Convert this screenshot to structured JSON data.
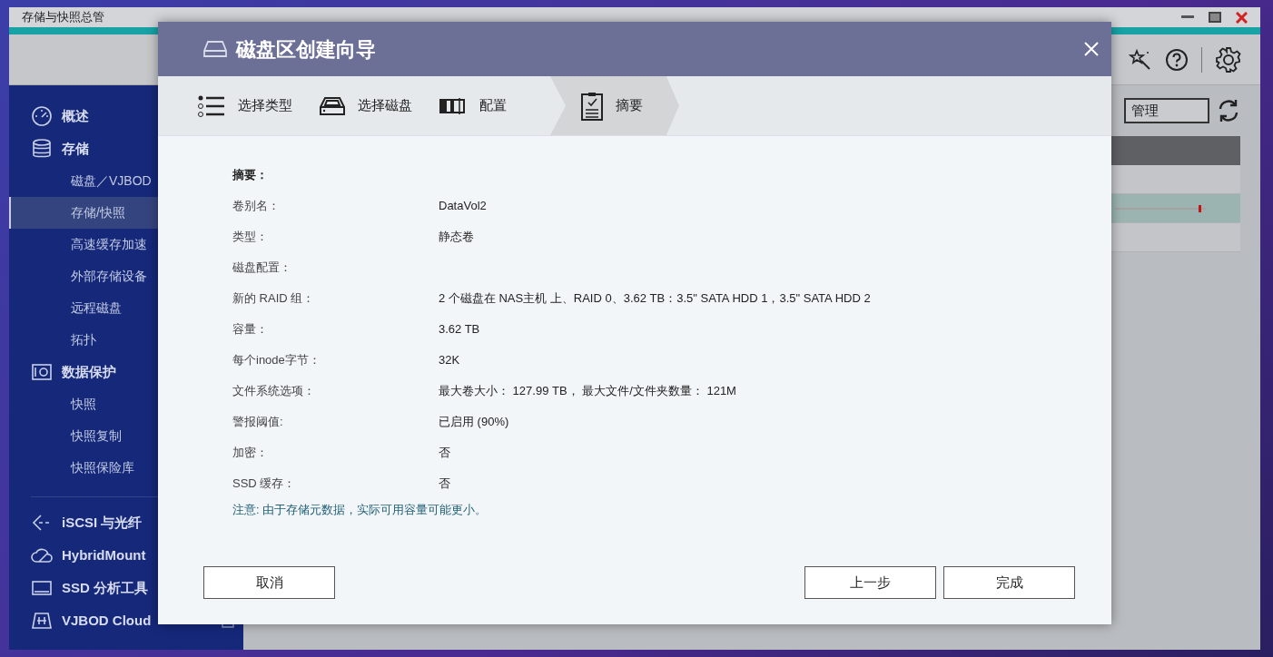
{
  "app": {
    "title": "存储与快照总管"
  },
  "sidebar": {
    "groups": [
      [
        {
          "label": "概述",
          "selected": false
        },
        {
          "label": "存储",
          "selected": false,
          "children": [
            {
              "label": "磁盘／VJBOD",
              "selected": false
            },
            {
              "label": "存储/快照",
              "selected": true
            },
            {
              "label": "高速缓存加速",
              "selected": false
            },
            {
              "label": "外部存储设备",
              "selected": false
            },
            {
              "label": "远程磁盘",
              "selected": false
            },
            {
              "label": "拓扑",
              "selected": false
            }
          ]
        },
        {
          "label": "数据保护",
          "selected": false,
          "children": [
            {
              "label": "快照",
              "selected": false
            },
            {
              "label": "快照复制",
              "selected": false
            },
            {
              "label": "快照保险库",
              "selected": false
            }
          ]
        }
      ],
      [
        {
          "label": "iSCSI 与光纤",
          "selected": false
        },
        {
          "label": "HybridMount",
          "selected": false
        },
        {
          "label": "SSD 分析工具",
          "selected": false
        },
        {
          "label": "VJBOD Cloud",
          "selected": false
        }
      ]
    ]
  },
  "toolbar": {
    "manage_button": "管理"
  },
  "dialog": {
    "title": "磁盘区创建向导",
    "steps": [
      {
        "label": "选择类型",
        "selected": false
      },
      {
        "label": "选择磁盘",
        "selected": false
      },
      {
        "label": "配置",
        "selected": false
      },
      {
        "label": "摘要",
        "selected": true
      }
    ],
    "summary_heading": "摘要：",
    "rows": [
      {
        "label": "卷别名：",
        "value": "DataVol2"
      },
      {
        "label": "类型：",
        "value": "静态卷"
      },
      {
        "label": "磁盘配置："
      },
      {
        "label": "新的 RAID 组：",
        "value": "2 个磁盘在 NAS主机 上、RAID 0、3.62 TB：3.5\" SATA HDD 1，3.5\" SATA HDD 2"
      },
      {
        "label": "容量：",
        "value": "3.62 TB"
      },
      {
        "label": "每个inode字节：",
        "value": "32K"
      },
      {
        "label": "文件系统选项：",
        "value": "最大卷大小： 127.99 TB， 最大文件/文件夹数量： 121M"
      },
      {
        "label": "警报阈值:",
        "value": "已启用 (90%)"
      },
      {
        "label": "加密：",
        "value": "否"
      },
      {
        "label": "SSD 缓存：",
        "value": "否"
      }
    ],
    "note": "注意: 由于存储元数据，实际可用容量可能更小。",
    "buttons": {
      "cancel": "取消",
      "back": "上一步",
      "finish": "完成"
    }
  }
}
